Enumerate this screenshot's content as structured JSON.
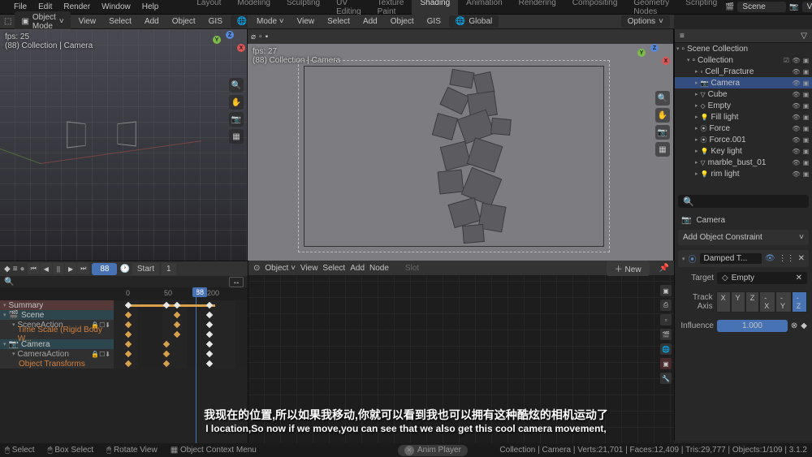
{
  "top_menu": [
    "File",
    "Edit",
    "Render",
    "Window",
    "Help"
  ],
  "workspaces": [
    "Layout",
    "Modeling",
    "Sculpting",
    "UV Editing",
    "Texture Paint",
    "Shading",
    "Animation",
    "Rendering",
    "Compositing",
    "Geometry Nodes",
    "Scripting"
  ],
  "active_workspace": "Shading",
  "scene_name": "Scene",
  "viewlayer_name": "ViewLayer",
  "header": {
    "mode": "Object Mode",
    "menus": [
      "View",
      "Select",
      "Add",
      "Object",
      "GIS"
    ],
    "orientation": "Global"
  },
  "viewport_left": {
    "fps": "fps: 25",
    "context": "(88) Collection | Camera"
  },
  "viewport_right": {
    "fps": "fps: 27",
    "context": "(88) Collection | Camera",
    "options": "Options"
  },
  "outliner": {
    "root": "Scene Collection",
    "collection": "Collection",
    "items": [
      {
        "name": "Cell_Fracture",
        "type": "collection"
      },
      {
        "name": "Camera",
        "type": "camera",
        "selected": true
      },
      {
        "name": "Cube",
        "type": "mesh"
      },
      {
        "name": "Empty",
        "type": "empty"
      },
      {
        "name": "Fill light",
        "type": "light"
      },
      {
        "name": "Force",
        "type": "force"
      },
      {
        "name": "Force.001",
        "type": "force"
      },
      {
        "name": "Key light",
        "type": "light"
      },
      {
        "name": "marble_bust_01",
        "type": "mesh"
      },
      {
        "name": "rim light",
        "type": "light"
      }
    ]
  },
  "properties": {
    "object": "Camera",
    "section": "Add Object Constraint",
    "constraint_name": "Damped T...",
    "target_label": "Target",
    "target_value": "Empty",
    "track_label": "Track Axis",
    "track_options": [
      "X",
      "Y",
      "Z",
      "-X",
      "-Y",
      "-Z"
    ],
    "track_active": "-Z",
    "influence_label": "Influence",
    "influence_value": "1.000"
  },
  "timeline": {
    "controls": [
      "⏮",
      "◀",
      "||",
      "▶",
      "⏭"
    ],
    "frame": "88",
    "start": "Start",
    "start_val": "1",
    "markers": [
      "0",
      "50",
      "88",
      "200"
    ],
    "summary": "Summary",
    "tracks": [
      "Scene",
      "SceneAction",
      "Time Scale (Rigid Body W...",
      "Camera",
      "CameraAction",
      "Object Transforms"
    ]
  },
  "node_editor": {
    "mode": "Object",
    "menus": [
      "View",
      "Select",
      "Add",
      "Node"
    ],
    "slot": "Slot",
    "new": "New"
  },
  "status_bar": {
    "left": [
      {
        "icon": "🖱",
        "label": "Select"
      },
      {
        "icon": "🖱",
        "label": "Box Select"
      },
      {
        "icon": "🖱",
        "label": "Rotate View"
      },
      {
        "icon": "▦",
        "label": "Object Context Menu"
      }
    ],
    "center": "Anim Player",
    "stats": "Collection | Camera | Verts:21,701 | Faces:12,409 | Tris:29,777 | Objects:1/109 | 3.1.2"
  },
  "subtitle": {
    "line1": "我现在的位置,所以如果我移动,你就可以看到我也可以拥有这种酷炫的相机运动了",
    "line2": "I location,So now if we move,you can see that we also get this cool camera movement,"
  }
}
